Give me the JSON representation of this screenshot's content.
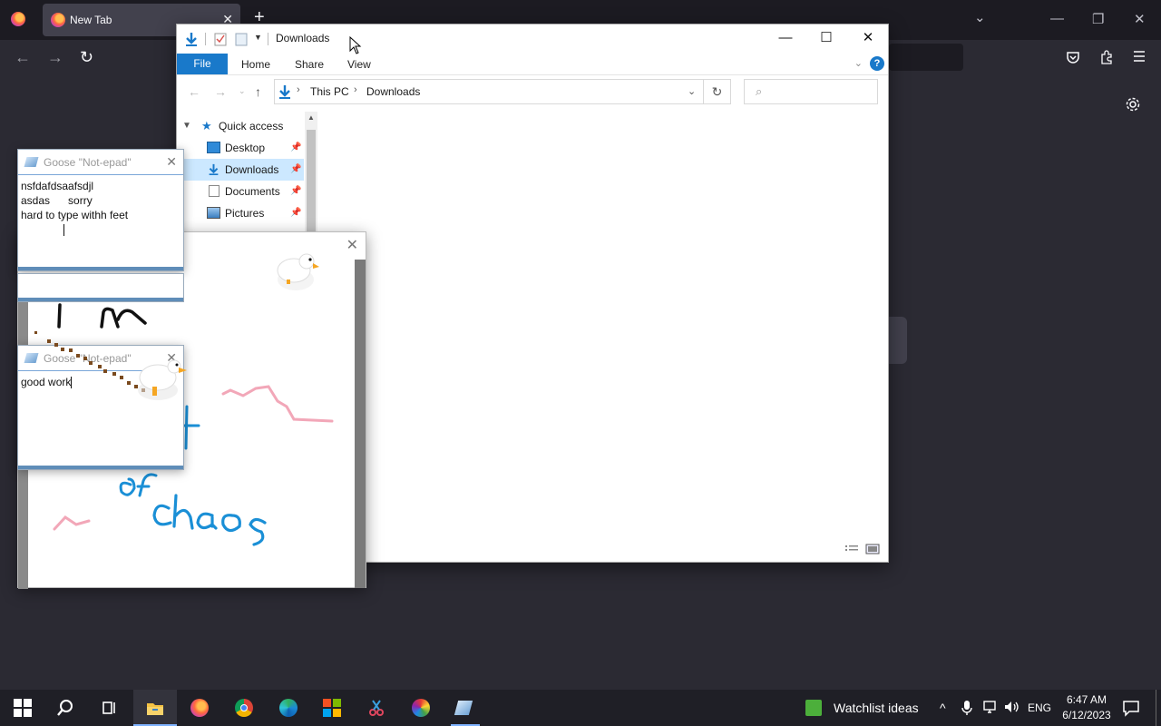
{
  "browser": {
    "tab_label": "New Tab",
    "tab_close": "✕",
    "new_tab": "+",
    "list_all_tabs": "⌄",
    "minimize": "—",
    "restore": "❐",
    "close": "✕"
  },
  "explorer": {
    "title": "Downloads",
    "ribbon_tabs": {
      "file": "File",
      "home": "Home",
      "share": "Share",
      "view": "View"
    },
    "help": "?",
    "breadcrumbs": [
      "This PC",
      "Downloads"
    ],
    "search_placeholder": "",
    "nav_pane": {
      "quick_access": "Quick access",
      "items": [
        {
          "label": "Desktop"
        },
        {
          "label": "Downloads"
        },
        {
          "label": "Documents"
        },
        {
          "label": "Pictures"
        }
      ]
    }
  },
  "notepad_top": {
    "title": "Goose \"Not-epad\"",
    "text": "nsfdafdsaafsdjl\nasdas      sorry\nhard to type withh feet\n"
  },
  "notepad_bottom": {
    "title": "Goose \"Not-epad\"",
    "text": "good work"
  },
  "drawing": {
    "words": [
      "I'm",
      "of",
      "chaos"
    ]
  },
  "taskbar": {
    "news_text": "Watchlist ideas",
    "language": "ENG",
    "time": "6:47 AM",
    "date": "6/12/2023"
  },
  "colors": {
    "accent": "#1979ca",
    "selection": "#cce8ff",
    "drawing_blue": "#1a8fd6",
    "drawing_pink": "#f2a7b8",
    "goose_footprint": "#7a4a1e"
  }
}
